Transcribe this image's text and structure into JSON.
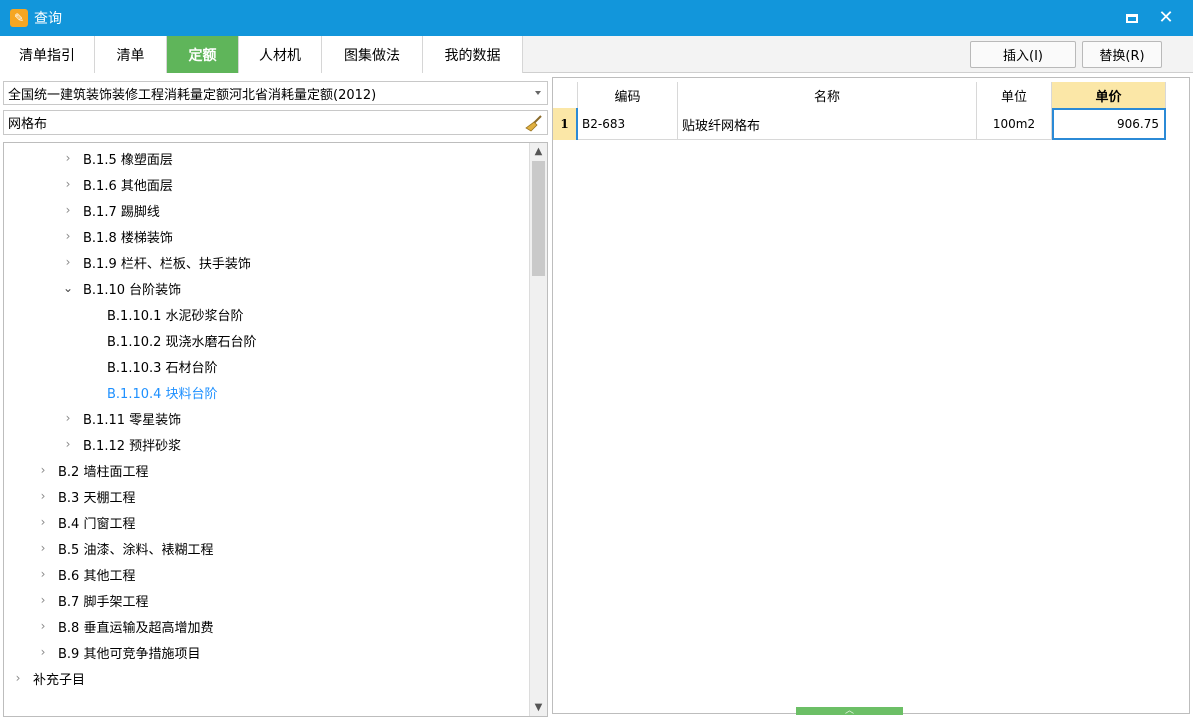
{
  "window": {
    "title": "查询"
  },
  "tabs": [
    {
      "label": "清单指引"
    },
    {
      "label": "清单"
    },
    {
      "label": "定额"
    },
    {
      "label": "人材机"
    },
    {
      "label": "图集做法"
    },
    {
      "label": "我的数据"
    }
  ],
  "active_tab": "定额",
  "actions": {
    "insert": "插入(I)",
    "replace": "替换(R)"
  },
  "left": {
    "library": "全国统一建筑装饰装修工程消耗量定额河北省消耗量定额(2012)",
    "search_value": "网格布",
    "tree": [
      {
        "label": "B.1.5 橡塑面层",
        "chevron": "›"
      },
      {
        "label": "B.1.6 其他面层",
        "chevron": "›"
      },
      {
        "label": "B.1.7 踢脚线",
        "chevron": "›"
      },
      {
        "label": "B.1.8 楼梯装饰",
        "chevron": "›"
      },
      {
        "label": "B.1.9 栏杆、栏板、扶手装饰",
        "chevron": "›"
      },
      {
        "label": "B.1.10 台阶装饰",
        "chevron": "⌄"
      },
      {
        "label": "B.1.10.1 水泥砂浆台阶",
        "chevron": ""
      },
      {
        "label": "B.1.10.2 现浇水磨石台阶",
        "chevron": ""
      },
      {
        "label": "B.1.10.3 石材台阶",
        "chevron": ""
      },
      {
        "label": "B.1.10.4 块料台阶",
        "chevron": ""
      },
      {
        "label": "B.1.11 零星装饰",
        "chevron": "›"
      },
      {
        "label": "B.1.12 预拌砂浆",
        "chevron": "›"
      },
      {
        "label": "B.2 墙柱面工程",
        "chevron": "›"
      },
      {
        "label": "B.3 天棚工程",
        "chevron": "›"
      },
      {
        "label": "B.4 门窗工程",
        "chevron": "›"
      },
      {
        "label": "B.5 油漆、涂料、裱糊工程",
        "chevron": "›"
      },
      {
        "label": "B.6 其他工程",
        "chevron": "›"
      },
      {
        "label": "B.7 脚手架工程",
        "chevron": "›"
      },
      {
        "label": "B.8 垂直运输及超高增加费",
        "chevron": "›"
      },
      {
        "label": "B.9 其他可竞争措施项目",
        "chevron": "›"
      },
      {
        "label": "补充子目",
        "chevron": "›"
      }
    ]
  },
  "grid": {
    "columns": [
      "编码",
      "名称",
      "单位",
      "单价"
    ],
    "rows": [
      {
        "index": "1",
        "code": "B2-683",
        "name": "贴玻纤网格布",
        "unit": "100m2",
        "price": "906.75"
      }
    ]
  },
  "colors": {
    "titlebar": "#1296db",
    "active_tab": "#5fb55a",
    "selected_text": "#1e90ff",
    "header_highlight": "#fbe7a7"
  }
}
